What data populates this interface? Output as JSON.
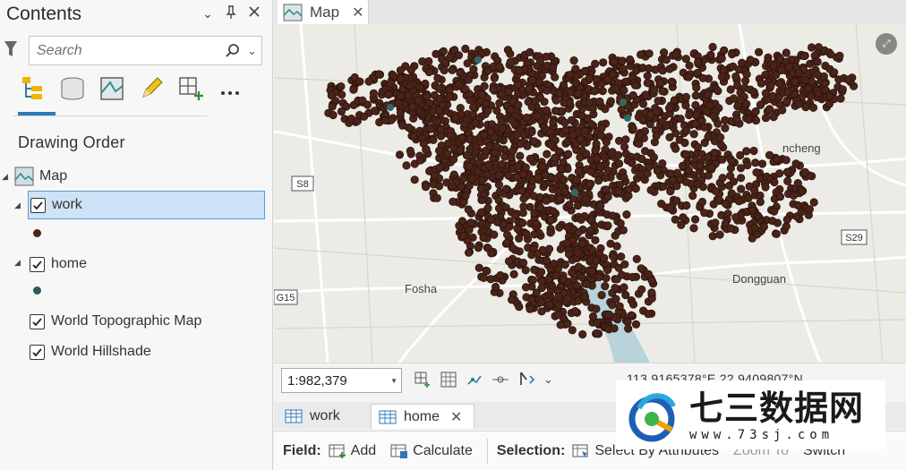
{
  "contents": {
    "title": "Contents",
    "window_buttons": [
      "chevron-down-icon",
      "pin-icon",
      "close-icon"
    ],
    "search": {
      "placeholder": "Search",
      "value": ""
    },
    "toolbar_icons": [
      "list-by-drawing-order-icon",
      "list-by-data-source-icon",
      "list-by-selection-icon",
      "list-by-editing-icon",
      "list-by-snapping-icon",
      "more-icon"
    ],
    "section_heading": "Drawing Order",
    "layers": {
      "map": {
        "label": "Map"
      },
      "work": {
        "label": "work",
        "checked": true,
        "symbol_color": "#4a2418"
      },
      "home": {
        "label": "home",
        "checked": true,
        "symbol_color": "#2f5a5a"
      },
      "topo": {
        "label": "World Topographic Map",
        "checked": true
      },
      "hillshade": {
        "label": "World Hillshade",
        "checked": true
      }
    }
  },
  "map_view": {
    "tab_label": "Map",
    "labels": {
      "s8": "S8",
      "g15": "G15",
      "s29": "S29",
      "foshan": "Fosha",
      "dongguan": "Dongguan",
      "cheng": "ncheng"
    },
    "point_color": "#4a2418",
    "point_outline": "#2a120c",
    "home_point_color": "#2f6b66"
  },
  "status_bar": {
    "scale": "1:982,379",
    "coordinates": "113.9165378°E 22.9409807°N"
  },
  "attribute_pane": {
    "tabs": [
      {
        "label": "work",
        "active": false
      },
      {
        "label": "home",
        "active": true
      }
    ],
    "field_label": "Field:",
    "add_label": "Add",
    "calculate_label": "Calculate",
    "selection_label": "Selection:",
    "select_by_attributes_label": "Select By Attributes",
    "zoom_to_label": "Zoom To",
    "switch_label": "Switch"
  },
  "watermark": {
    "title": "七三数据网",
    "url": "www.73sj.com"
  }
}
